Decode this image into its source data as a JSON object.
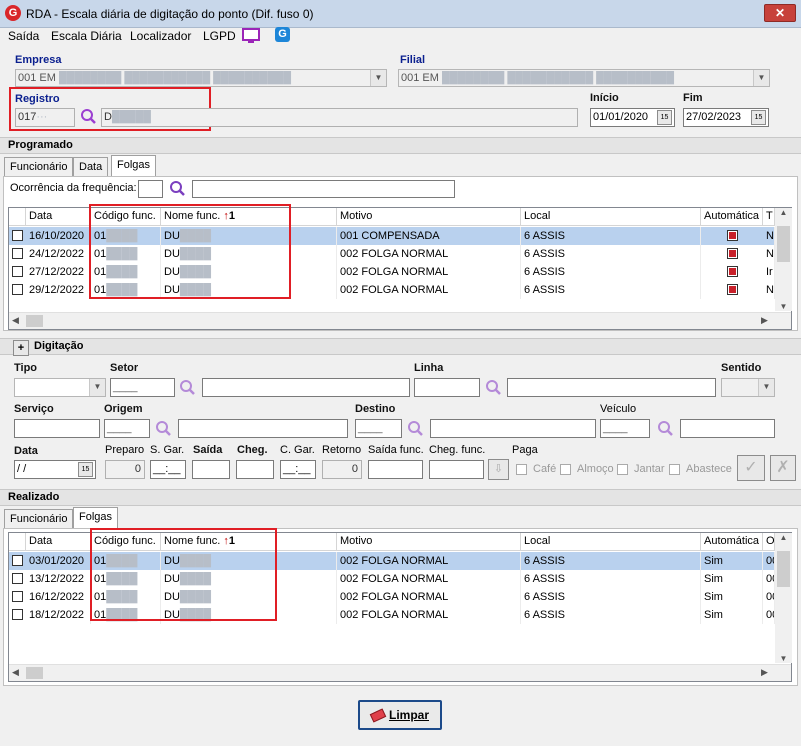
{
  "window": {
    "title": "RDA - Escala diária de digitação do ponto (Dif. fuso 0)",
    "close": "✕"
  },
  "menu": {
    "items": [
      "Saída",
      "Escala Diária",
      "Localizador",
      "LGPD"
    ]
  },
  "header": {
    "empresa_label": "Empresa",
    "empresa_value": "001 EM",
    "filial_label": "Filial",
    "filial_value": "001 EM",
    "registro_label": "Registro",
    "registro_code": "017",
    "registro_name": "D",
    "inicio_label": "Início",
    "inicio_value": "01/01/2020",
    "fim_label": "Fim",
    "fim_value": "27/02/2023",
    "cal_label": "15"
  },
  "programado": {
    "title": "Programado",
    "tabs": [
      "Funcionário",
      "Data",
      "Folgas"
    ],
    "ocorrencia_label": "Ocorrência da frequência:",
    "columns": [
      "Data",
      "Código func.",
      "Nome func.",
      "Motivo",
      "Local",
      "Automática",
      "T"
    ],
    "sort_indicator": "1",
    "rows": [
      {
        "data": "16/10/2020",
        "codigo": "01",
        "nome": "DU",
        "motivo": "001 COMPENSADA",
        "local": "6 ASSIS",
        "t": "N"
      },
      {
        "data": "24/12/2022",
        "codigo": "01",
        "nome": "DU",
        "motivo": "002 FOLGA NORMAL",
        "local": "6 ASSIS",
        "t": "N"
      },
      {
        "data": "27/12/2022",
        "codigo": "01",
        "nome": "DU",
        "motivo": "002 FOLGA NORMAL",
        "local": "6 ASSIS",
        "t": "Ir"
      },
      {
        "data": "29/12/2022",
        "codigo": "01",
        "nome": "DU",
        "motivo": "002 FOLGA NORMAL",
        "local": "6 ASSIS",
        "t": "N"
      }
    ]
  },
  "digitacao": {
    "title": "Digitação",
    "expand": "+",
    "tipo": "Tipo",
    "setor": "Setor",
    "linha": "Linha",
    "sentido": "Sentido",
    "servico": "Serviço",
    "origem": "Origem",
    "destino": "Destino",
    "veiculo": "Veículo",
    "data": "Data",
    "preparo": "Preparo",
    "sgar": "S. Gar.",
    "saida": "Saída",
    "cheg": "Cheg.",
    "cgar": "C. Gar.",
    "retorno": "Retorno",
    "saida_func": "Saída func.",
    "cheg_func": "Cheg. func.",
    "paga": "Paga",
    "data_value": " / /",
    "preparo_value": "0",
    "sgar_value": "__:__",
    "cgar_value": "__:__",
    "retorno_value": "0",
    "cafe": "Café",
    "almoco": "Almoço",
    "jantar": "Jantar",
    "abastece": "Abastece"
  },
  "realizado": {
    "title": "Realizado",
    "tabs": [
      "Funcionário",
      "Folgas"
    ],
    "columns": [
      "Data",
      "Código func.",
      "Nome func.",
      "Motivo",
      "Local",
      "Automática",
      "O"
    ],
    "sort_indicator": "1",
    "rows": [
      {
        "data": "03/01/2020",
        "codigo": "01",
        "nome": "DU",
        "motivo": "002 FOLGA NORMAL",
        "local": "6 ASSIS",
        "auto": "Sim",
        "o": "00"
      },
      {
        "data": "13/12/2022",
        "codigo": "01",
        "nome": "DU",
        "motivo": "002 FOLGA NORMAL",
        "local": "6 ASSIS",
        "auto": "Sim",
        "o": "00"
      },
      {
        "data": "16/12/2022",
        "codigo": "01",
        "nome": "DU",
        "motivo": "002 FOLGA NORMAL",
        "local": "6 ASSIS",
        "auto": "Sim",
        "o": "00"
      },
      {
        "data": "18/12/2022",
        "codigo": "01",
        "nome": "DU",
        "motivo": "002 FOLGA NORMAL",
        "local": "6 ASSIS",
        "auto": "Sim",
        "o": "00"
      }
    ]
  },
  "footer": {
    "limpar": "Limpar"
  },
  "colors": {
    "selection": "#b9d1ee",
    "highlight": "#e01e25",
    "accent": "#7b3fbf"
  }
}
